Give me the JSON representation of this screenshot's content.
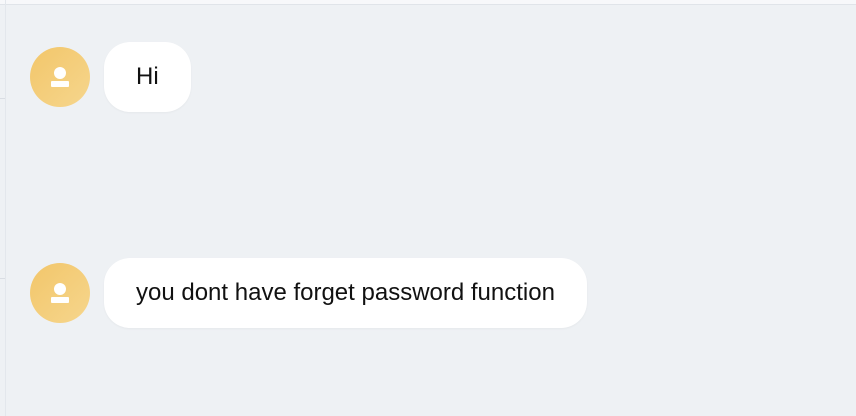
{
  "chat": {
    "messages": [
      {
        "text": "Hi",
        "avatar_icon": "user-avatar-icon"
      },
      {
        "text": "you dont have forget password function",
        "avatar_icon": "user-avatar-icon"
      }
    ]
  },
  "colors": {
    "background": "#eef1f4",
    "bubble": "#ffffff",
    "avatar": "#f2c66a"
  }
}
